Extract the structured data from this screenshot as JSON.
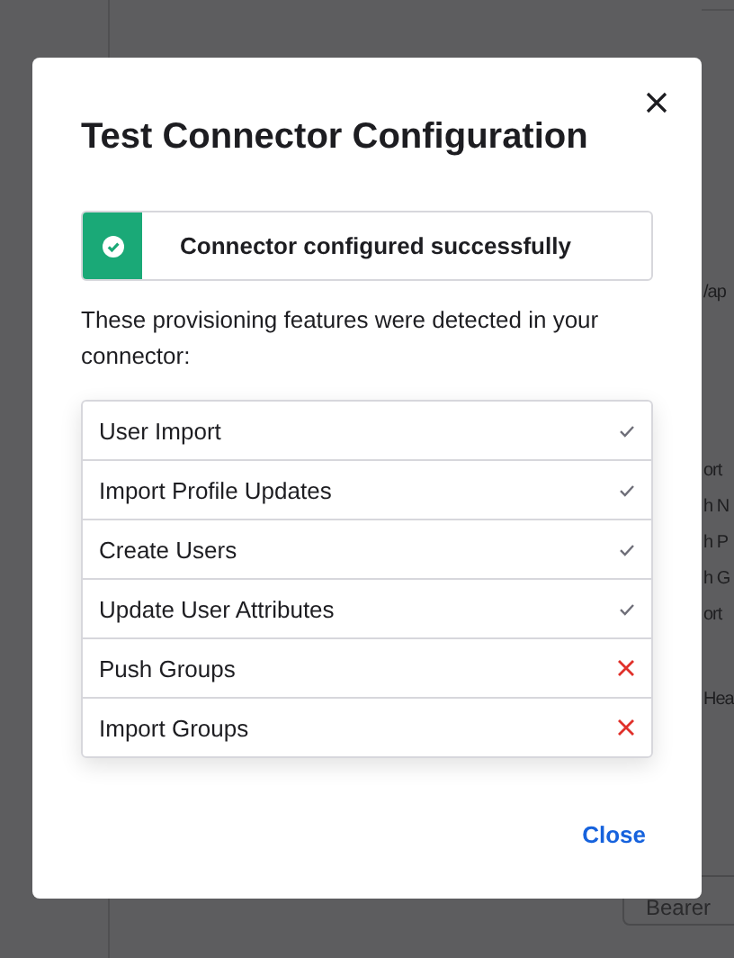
{
  "background": {
    "fragments": [
      {
        "text": "/ap"
      },
      {
        "text": "ort"
      },
      {
        "text": "h N"
      },
      {
        "text": "h P"
      },
      {
        "text": "h G"
      },
      {
        "text": "ort"
      },
      {
        "text": "Hea"
      }
    ],
    "button": "Bearer"
  },
  "dialog": {
    "title": "Test Connector Configuration",
    "banner": {
      "kind": "success",
      "text": "Connector configured successfully"
    },
    "description": "These provisioning features were detected in your connector:",
    "features": [
      {
        "label": "User Import",
        "detected": true
      },
      {
        "label": "Import Profile Updates",
        "detected": true
      },
      {
        "label": "Create Users",
        "detected": true
      },
      {
        "label": "Update User Attributes",
        "detected": true
      },
      {
        "label": "Push Groups",
        "detected": false
      },
      {
        "label": "Import Groups",
        "detected": false
      }
    ],
    "close_link": "Close"
  }
}
